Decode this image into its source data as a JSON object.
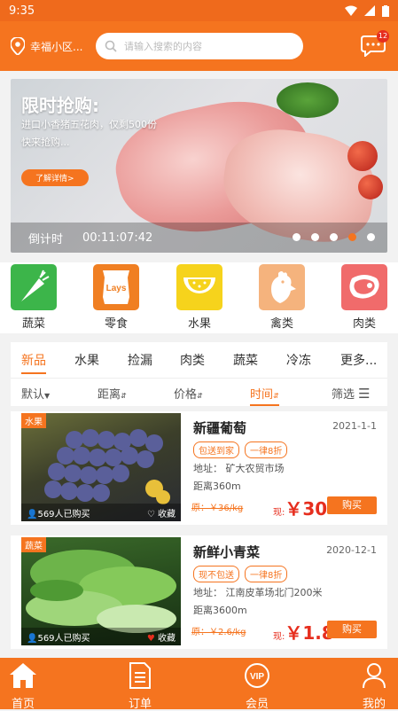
{
  "status": {
    "time": "9:35"
  },
  "header": {
    "location": "幸福小区...",
    "search_placeholder": "请输入搜索的内容",
    "msg_count": "12"
  },
  "banner": {
    "title": "限时抢购:",
    "desc": "进口小香猪五花肉，仅剩500份快来抢购...",
    "more": "了解详情>",
    "countdown_label": "倒计时",
    "countdown_time": "00:11:07:42",
    "dots": 5,
    "active_dot": 4
  },
  "categories": [
    {
      "label": "蔬菜",
      "icon": "carrot-icon",
      "color": "#3cb54a"
    },
    {
      "label": "零食",
      "icon": "snack-bag-icon",
      "color": "#f07f22"
    },
    {
      "label": "水果",
      "icon": "watermelon-icon",
      "color": "#f6d31c"
    },
    {
      "label": "禽类",
      "icon": "rooster-icon",
      "color": "#f5b37d"
    },
    {
      "label": "肉类",
      "icon": "meat-icon",
      "color": "#f06b6b"
    }
  ],
  "tabs": [
    "新品",
    "水果",
    "捡漏",
    "肉类",
    "蔬菜",
    "冷冻",
    "更多..."
  ],
  "sorts": [
    "默认",
    "距离",
    "价格",
    "时间",
    "筛选"
  ],
  "products": [
    {
      "tag": "水果",
      "buyers": "569人已购买",
      "fav": "收藏",
      "name": "新疆葡萄",
      "date": "2021-1-1",
      "chip1": "包送到家",
      "chip2": "一律8折",
      "addr": "地址：  矿大农贸市场",
      "dist": "距离360m",
      "orig": "原：￥36/kg",
      "now_label": "现:",
      "price": "￥30",
      "buy": "购买"
    },
    {
      "tag": "蔬菜",
      "buyers": "569人已购买",
      "fav": "收藏",
      "name": "新鲜小青菜",
      "date": "2020-12-1",
      "chip1": "现不包送",
      "chip2": "一律8折",
      "addr": "地址：  江南皮革场北门200米",
      "dist": "距离3600m",
      "orig": "原：￥2.6/kg",
      "now_label": "现:",
      "price": "￥1.8",
      "buy": "购买"
    }
  ],
  "nav": [
    "首页",
    "订单",
    "会员",
    "我的"
  ],
  "colors": {
    "accent": "#f5741f",
    "price": "#e62e1e"
  }
}
